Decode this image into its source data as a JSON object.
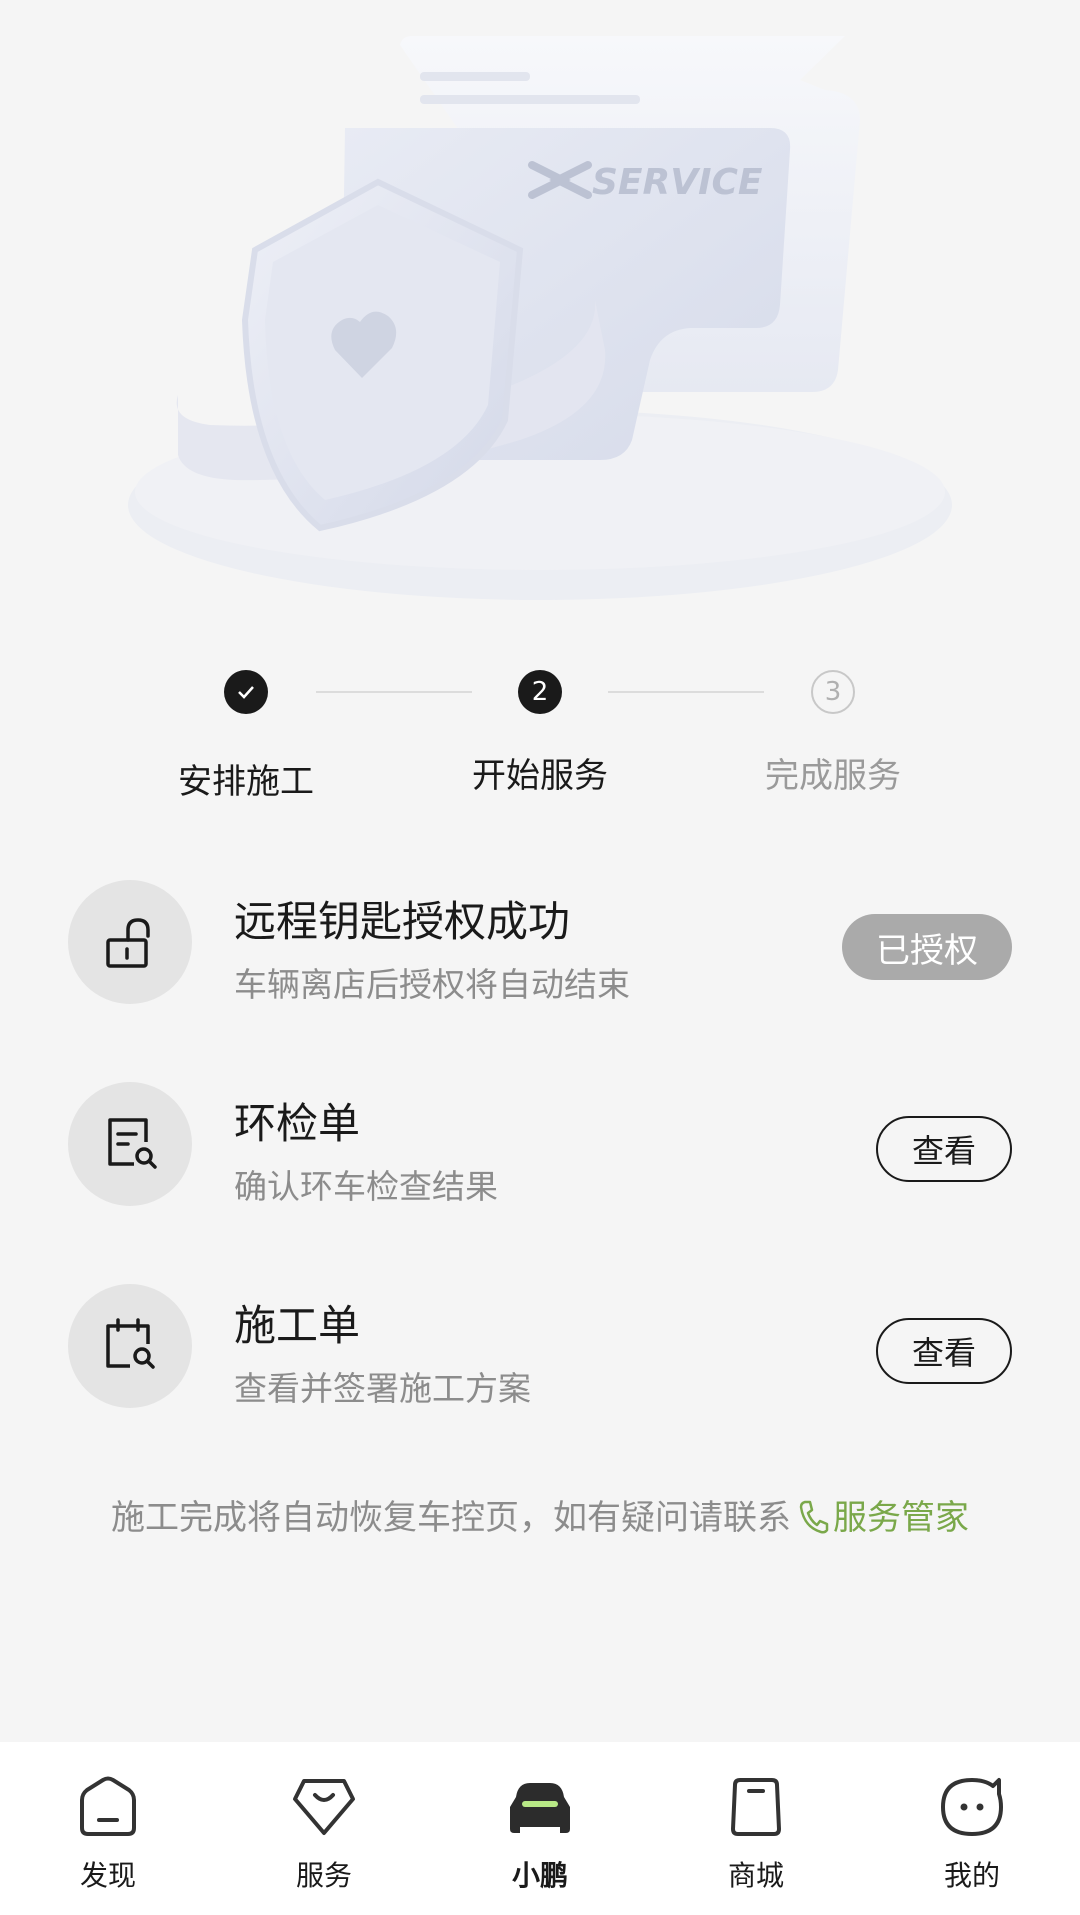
{
  "hero": {
    "card_brand_text": "SERVICE"
  },
  "stepper": {
    "steps": [
      {
        "label": "安排施工",
        "status": "done",
        "marker": "✓"
      },
      {
        "label": "开始服务",
        "status": "active",
        "marker": "2"
      },
      {
        "label": "完成服务",
        "status": "pending",
        "marker": "3"
      }
    ]
  },
  "services": [
    {
      "title": "远程钥匙授权成功",
      "subtitle": "车辆离店后授权将自动结束",
      "button": "已授权",
      "icon": "unlock-icon"
    },
    {
      "title": "环检单",
      "subtitle": "确认环车检查结果",
      "button": "查看",
      "icon": "document-search-icon"
    },
    {
      "title": "施工单",
      "subtitle": "查看并签署施工方案",
      "button": "查看",
      "icon": "calendar-search-icon"
    }
  ],
  "footer_note": {
    "text": "施工完成将自动恢复车控页，如有疑问请联系",
    "link": "服务管家"
  },
  "tabbar": {
    "tabs": [
      {
        "label": "发现",
        "icon": "home-icon"
      },
      {
        "label": "服务",
        "icon": "diamond-icon"
      },
      {
        "label": "小鹏",
        "icon": "car-icon",
        "active": true
      },
      {
        "label": "商城",
        "icon": "bag-icon"
      },
      {
        "label": "我的",
        "icon": "face-icon"
      }
    ]
  },
  "colors": {
    "accent": "#7aa84a",
    "car_light": "#b8e986",
    "active_step": "#1a1a1a"
  }
}
